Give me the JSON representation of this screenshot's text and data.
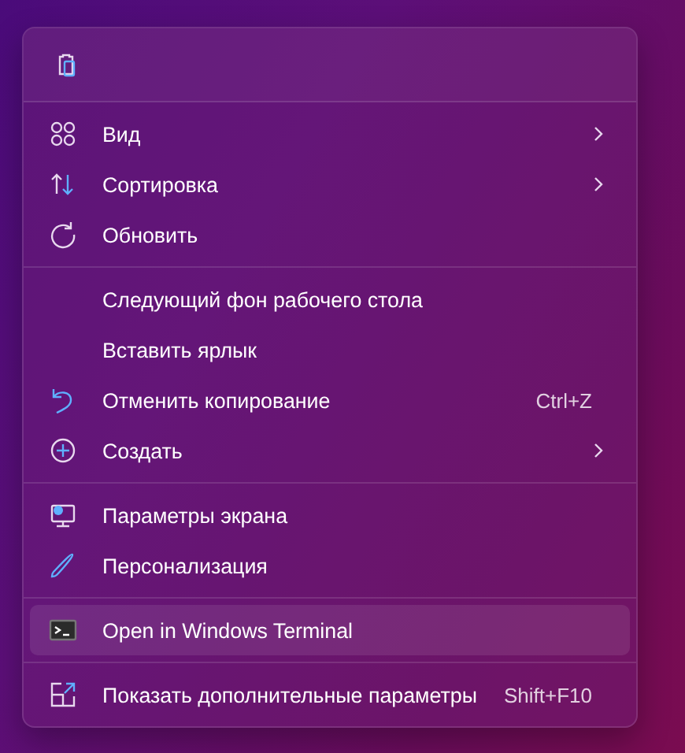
{
  "toolbar": [
    {
      "kind": "paste"
    }
  ],
  "sections": [
    {
      "items": [
        {
          "kind": "view",
          "label": "Вид",
          "submenu": true,
          "selected": false
        },
        {
          "kind": "sort",
          "label": "Сортировка",
          "submenu": true,
          "selected": false
        },
        {
          "kind": "refresh",
          "label": "Обновить",
          "submenu": false,
          "selected": false
        }
      ]
    },
    {
      "items": [
        {
          "kind": "plain",
          "label": "Следующий фон рабочего стола",
          "submenu": false,
          "selected": false
        },
        {
          "kind": "plain",
          "label": "Вставить ярлык",
          "submenu": false,
          "selected": false
        },
        {
          "kind": "undo",
          "label": "Отменить копирование",
          "shortcut": "Ctrl+Z",
          "submenu": false,
          "selected": false
        },
        {
          "kind": "new",
          "label": "Создать",
          "submenu": true,
          "selected": false
        }
      ]
    },
    {
      "items": [
        {
          "kind": "display",
          "label": "Параметры экрана",
          "submenu": false,
          "selected": false
        },
        {
          "kind": "personalize",
          "label": "Персонализация",
          "submenu": false,
          "selected": false
        }
      ]
    },
    {
      "items": [
        {
          "kind": "terminal",
          "label": "Open in Windows Terminal",
          "submenu": false,
          "selected": true
        }
      ]
    },
    {
      "items": [
        {
          "kind": "more",
          "label": "Показать дополнительные параметры",
          "shortcut": "Shift+F10",
          "submenu": false,
          "selected": false
        }
      ]
    }
  ]
}
